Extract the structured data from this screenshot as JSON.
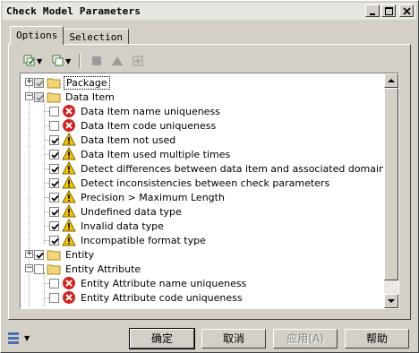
{
  "window": {
    "title": "Check Model Parameters"
  },
  "tabs": [
    {
      "label": "Options",
      "active": true
    },
    {
      "label": "Selection",
      "active": false
    }
  ],
  "toolbar": {
    "icons": [
      "select-all-icon",
      "dropdown-arrow",
      "deselect-icon",
      "dropdown-arrow",
      "stop-icon",
      "triangle-icon",
      "add-icon"
    ]
  },
  "tree": {
    "items": [
      {
        "label": "Package",
        "level": 0,
        "expander": "+",
        "checked": "grey",
        "icon": "folder-icon",
        "selected": true
      },
      {
        "label": "Data Item",
        "level": 0,
        "expander": "-",
        "checked": "grey",
        "icon": "folder-icon"
      },
      {
        "label": "Data Item name uniqueness",
        "level": 1,
        "checked": "none",
        "icon": "error-icon"
      },
      {
        "label": "Data Item code uniqueness",
        "level": 1,
        "checked": "none",
        "icon": "error-icon"
      },
      {
        "label": "Data Item not used",
        "level": 1,
        "checked": "checked",
        "icon": "warning-icon"
      },
      {
        "label": "Data Item used multiple times",
        "level": 1,
        "checked": "checked",
        "icon": "warning-icon"
      },
      {
        "label": "Detect differences between data item and associated domain",
        "level": 1,
        "checked": "checked",
        "icon": "warning-icon"
      },
      {
        "label": "Detect inconsistencies between check parameters",
        "level": 1,
        "checked": "checked",
        "icon": "warning-icon"
      },
      {
        "label": "Precision > Maximum Length",
        "level": 1,
        "checked": "checked",
        "icon": "warning-icon"
      },
      {
        "label": "Undefined data type",
        "level": 1,
        "checked": "checked",
        "icon": "warning-icon"
      },
      {
        "label": "Invalid data type",
        "level": 1,
        "checked": "checked",
        "icon": "warning-icon"
      },
      {
        "label": "Incompatible format type",
        "level": 1,
        "checked": "checked",
        "icon": "warning-icon"
      },
      {
        "label": "Entity",
        "level": 0,
        "expander": "+",
        "checked": "checked",
        "icon": "folder-icon"
      },
      {
        "label": "Entity Attribute",
        "level": 0,
        "expander": "-",
        "checked": "none",
        "icon": "folder-icon"
      },
      {
        "label": "Entity Attribute name uniqueness",
        "level": 1,
        "checked": "none",
        "icon": "error-icon"
      },
      {
        "label": "Entity Attribute code uniqueness",
        "level": 1,
        "checked": "none",
        "icon": "error-icon"
      }
    ]
  },
  "buttons": {
    "ok": "确定",
    "cancel": "取消",
    "apply": "应用(A)",
    "help": "帮助"
  },
  "colors": {
    "error": "#d42020",
    "warning": "#f2c400",
    "folder": "#f3d57a"
  }
}
